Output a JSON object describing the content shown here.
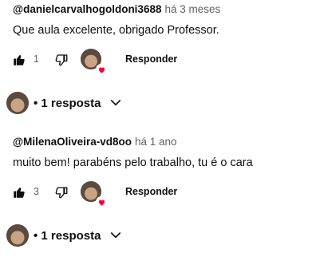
{
  "comments": [
    {
      "author": "@danielcarvalhogoldoni3688",
      "time": "há 3 meses",
      "text": "Que aula excelente, obrigado Professor.",
      "likes": "1",
      "reply_label": "Responder",
      "replies_label": "• 1 resposta"
    },
    {
      "author": "@MilenaOliveira-vd8oo",
      "time": "há 1 ano",
      "text": "muito bem! parabéns pelo trabalho, tu é o cara",
      "likes": "3",
      "reply_label": "Responder",
      "replies_label": "• 1 resposta"
    }
  ],
  "icons": {
    "like": "thumbs-up-icon",
    "dislike": "thumbs-down-icon",
    "creator_heart": "creator-heart-avatar",
    "expand": "chevron-down-icon"
  },
  "colors": {
    "text": "#0f0f0f",
    "secondary": "#606060",
    "heart": "#ff0033"
  }
}
